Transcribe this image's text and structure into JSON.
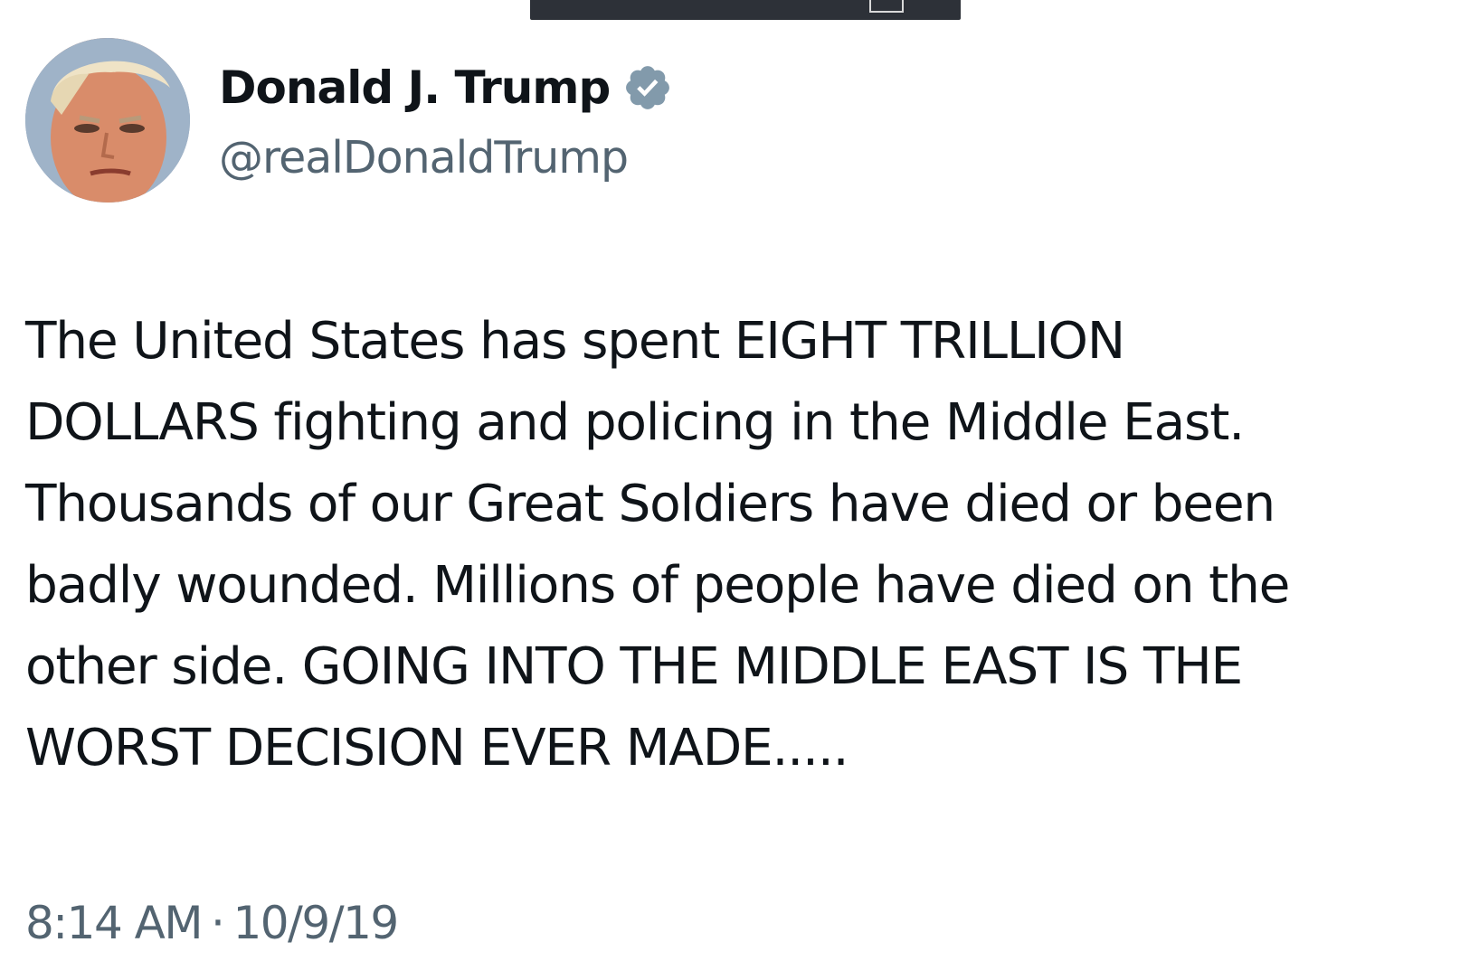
{
  "author": {
    "display_name": "Donald J. Trump",
    "handle": "@realDonaldTrump",
    "verified_icon": "verified-badge-icon",
    "badge_color": "#829aab"
  },
  "tweet": {
    "text": "The United States has spent EIGHT TRILLION\nDOLLARS fighting and policing in the Middle East.\nThousands of our Great Soldiers have died or been\nbadly wounded. Millions of people have died on the\nother side. GOING INTO THE MIDDLE EAST IS THE\nWORST DECISION EVER MADE.....",
    "time": "8:14 AM",
    "separator": "·",
    "date": "10/9/19"
  },
  "colors": {
    "text_primary": "#0f1419",
    "text_secondary": "#536471",
    "top_bar": "#2d3138"
  }
}
